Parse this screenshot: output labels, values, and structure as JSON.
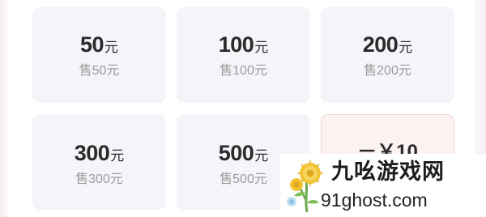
{
  "cards": [
    {
      "value": "50",
      "unit": "元",
      "price": "售50元"
    },
    {
      "value": "100",
      "unit": "元",
      "price": "售100元"
    },
    {
      "value": "200",
      "unit": "元",
      "price": "售200元"
    },
    {
      "value": "300",
      "unit": "元",
      "price": "售300元"
    },
    {
      "value": "500",
      "unit": "元",
      "price": "售500元"
    }
  ],
  "discount_card": {
    "label": "－￥10"
  },
  "watermark": {
    "site_name": "九吆游戏网",
    "url": "91ghost.com"
  },
  "colors": {
    "card_bg": "#f3f5f9",
    "highlight_card_bg": "#fdf2f2",
    "value_text": "#2a2a2a",
    "price_text": "#9b9b9b"
  }
}
